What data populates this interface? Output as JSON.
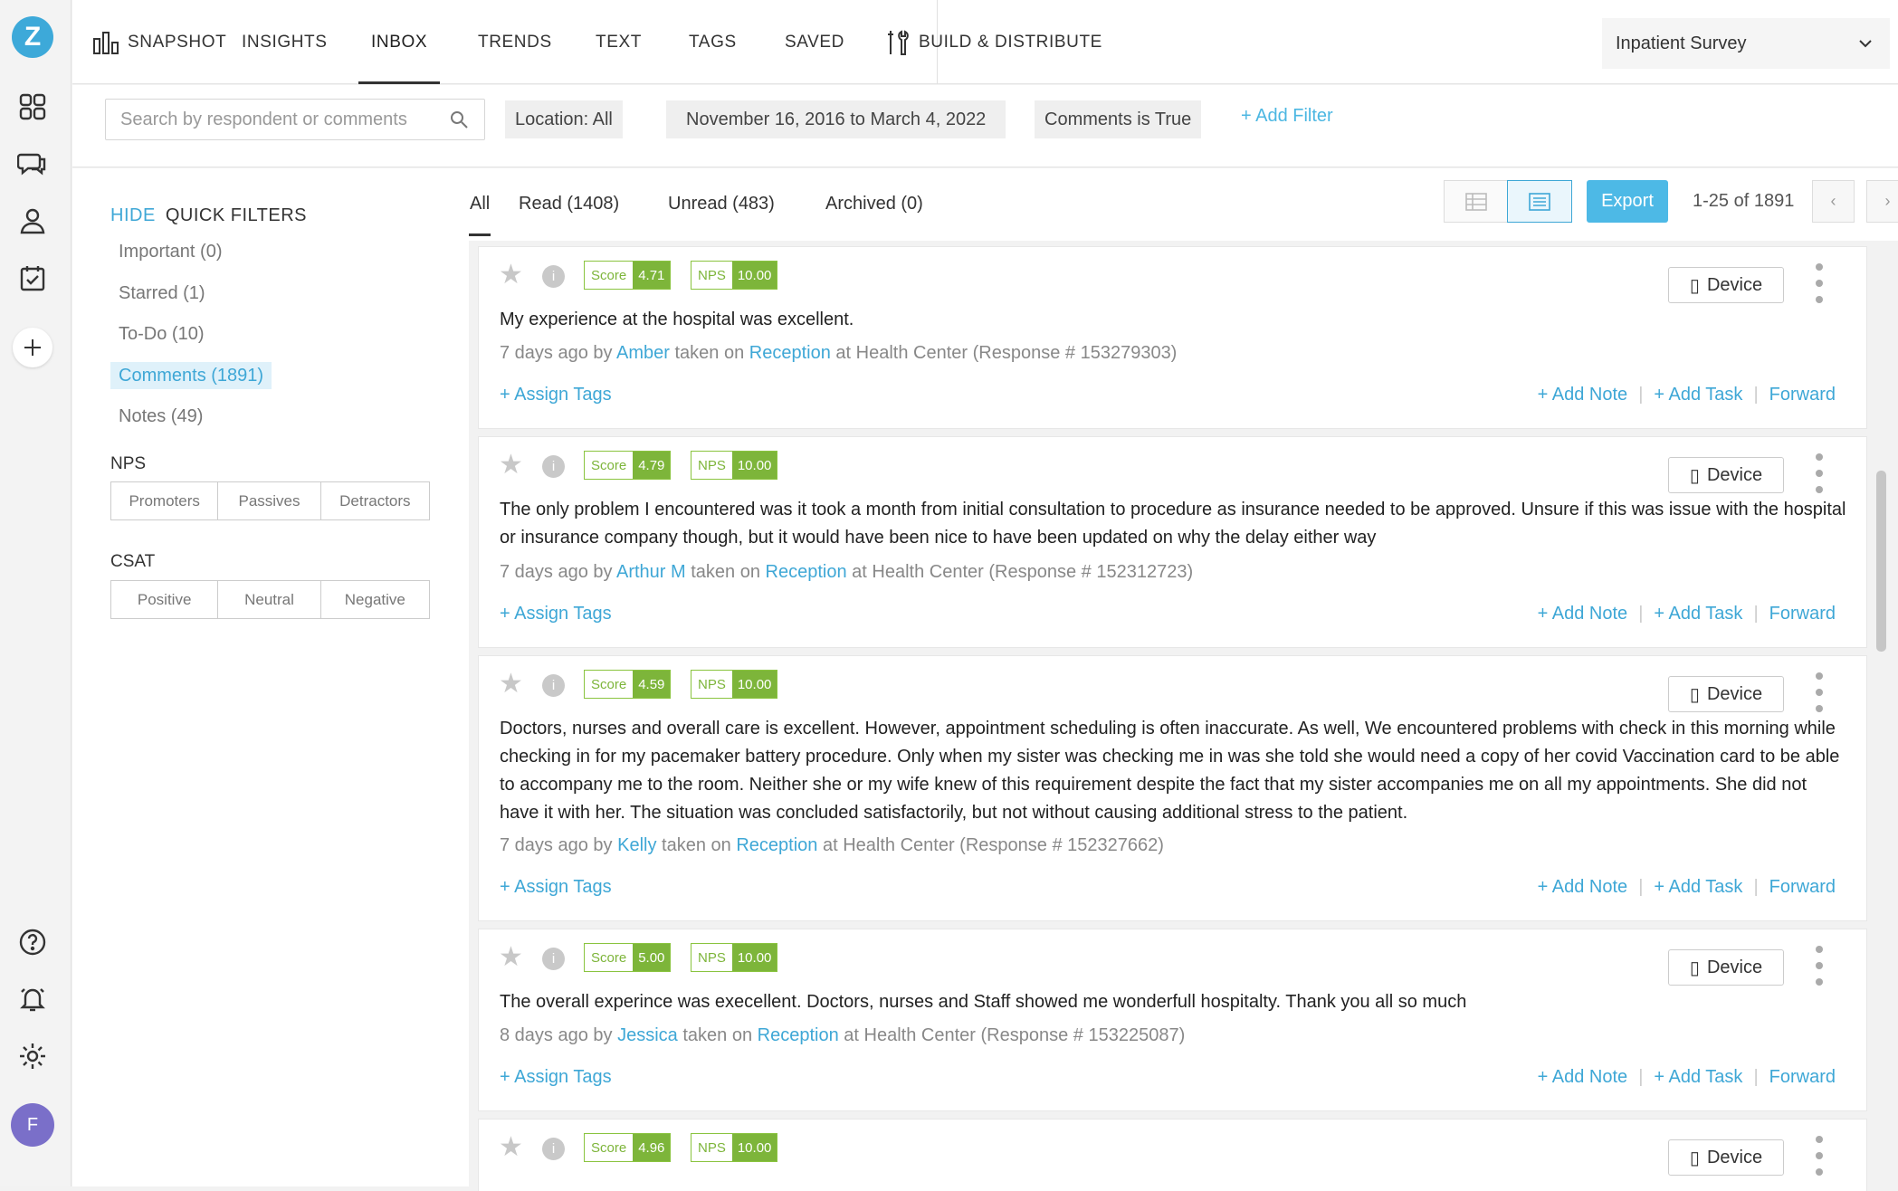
{
  "rail": {
    "logo": "Z",
    "avatar": "F"
  },
  "nav": {
    "snapshot": "SNAPSHOT",
    "insights": "INSIGHTS",
    "inbox": "INBOX",
    "trends": "TRENDS",
    "text": "TEXT",
    "tags": "TAGS",
    "saved": "SAVED",
    "build": "BUILD & DISTRIBUTE",
    "survey": "Inpatient Survey"
  },
  "filters": {
    "search_placeholder": "Search by respondent or comments",
    "location": "Location: All",
    "date_range": "November 16, 2016 to March 4, 2022",
    "comments": "Comments is True",
    "add_filter": "+ Add Filter"
  },
  "quick": {
    "hide": "HIDE",
    "title": "QUICK FILTERS",
    "items": [
      "Important (0)",
      "Starred (1)",
      "To-Do (10)",
      "Comments (1891)",
      "Notes (49)"
    ],
    "nps_label": "NPS",
    "nps": [
      "Promoters",
      "Passives",
      "Detractors"
    ],
    "csat_label": "CSAT",
    "csat": [
      "Positive",
      "Neutral",
      "Negative"
    ]
  },
  "tabs": {
    "all": "All",
    "read": "Read (1408)",
    "unread": "Unread (483)",
    "archived": "Archived (0)"
  },
  "toolbar": {
    "export": "Export",
    "range": "1-25 of 1891"
  },
  "labels": {
    "score": "Score",
    "nps": "NPS",
    "device": "Device",
    "assign": "+ Assign Tags",
    "note": "+ Add Note",
    "task": "+ Add Task",
    "forward": "Forward",
    "by": "by",
    "taken_on": "taken on",
    "at": "at",
    "location": "Health Center",
    "resp": "(Response #"
  },
  "responses": [
    {
      "score": "4.71",
      "nps": "10.00",
      "text": "My experience at the hospital was excellent.",
      "ago": "7 days ago",
      "name": "Amber",
      "channel": "Reception",
      "id": "153279303)"
    },
    {
      "score": "4.79",
      "nps": "10.00",
      "text": "The only problem I encountered was it took a month from initial consultation to procedure as insurance needed to be approved. Unsure if this was issue with the hospital or insurance company though, but it would have been nice to have been updated on why the delay either way",
      "ago": "7 days ago",
      "name": "Arthur M",
      "channel": "Reception",
      "id": "152312723)"
    },
    {
      "score": "4.59",
      "nps": "10.00",
      "text": "Doctors, nurses and overall care is excellent. However, appointment scheduling is often inaccurate. As well, We encountered problems with check in this morning while checking in for my pacemaker battery procedure. Only when my sister was checking me in was she told she would need a copy of her covid Vaccination card to be able to accompany me to the room. Neither she or my wife knew of this requirement despite the fact that my sister accompanies me on all my appointments. She did not have it with her. The situation was concluded satisfactorily, but not without causing additional stress to the patient.",
      "ago": "7 days ago",
      "name": "Kelly",
      "channel": "Reception",
      "id": "152327662)"
    },
    {
      "score": "5.00",
      "nps": "10.00",
      "text": "The overall experince was execellent. Doctors, nurses and Staff showed me wonderfull hospitalty. Thank you all so much",
      "ago": "8 days ago",
      "name": "Jessica",
      "channel": "Reception",
      "id": "153225087)"
    },
    {
      "score": "4.96",
      "nps": "10.00"
    }
  ]
}
